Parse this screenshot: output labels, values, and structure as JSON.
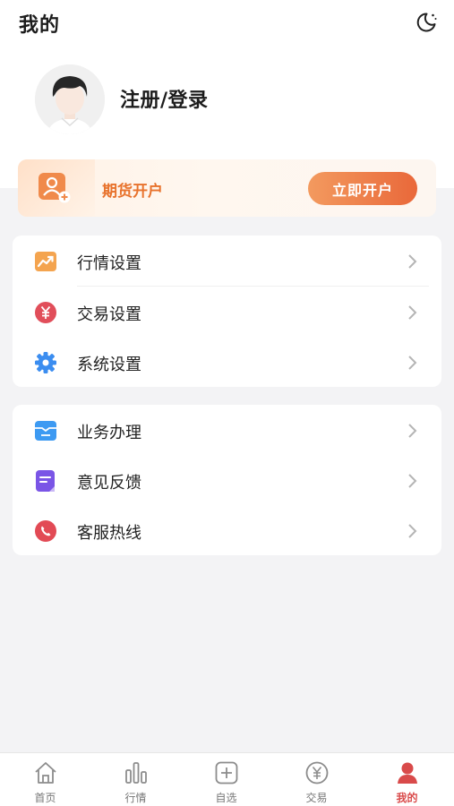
{
  "header": {
    "title": "我的",
    "theme_toggle_icon": "moon-icon"
  },
  "profile": {
    "login_label": "注册/登录",
    "avatar_icon": "user-avatar"
  },
  "promo": {
    "label": "期货开户",
    "button_label": "立即开户",
    "icon": "account-open-icon",
    "accent_color": "#e8722c"
  },
  "menu_group_1": [
    {
      "label": "行情设置",
      "icon": "market-trend-icon"
    },
    {
      "label": "交易设置",
      "icon": "yuan-icon"
    },
    {
      "label": "系统设置",
      "icon": "gear-icon"
    }
  ],
  "menu_group_2": [
    {
      "label": "业务办理",
      "icon": "business-card-icon"
    },
    {
      "label": "意见反馈",
      "icon": "feedback-icon"
    },
    {
      "label": "客服热线",
      "icon": "phone-icon"
    }
  ],
  "tabbar": {
    "tabs": [
      {
        "label": "首页",
        "icon": "home-icon"
      },
      {
        "label": "行情",
        "icon": "bar-chart-icon"
      },
      {
        "label": "自选",
        "icon": "plus-square-icon"
      },
      {
        "label": "交易",
        "icon": "yuan-circle-icon"
      },
      {
        "label": "我的",
        "icon": "person-icon",
        "active": true
      }
    ],
    "active_color": "#d94a4a"
  }
}
